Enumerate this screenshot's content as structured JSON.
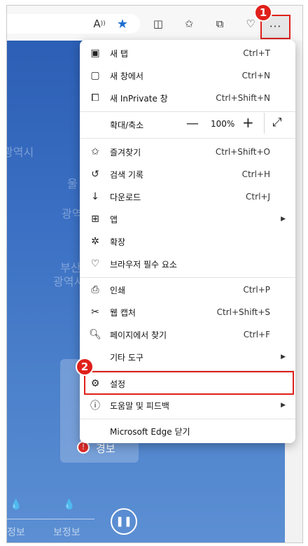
{
  "toolbar": {
    "icons": [
      "read-aloud-icon",
      "favorite-star-icon",
      "split-screen-icon",
      "favorites-icon",
      "collections-icon",
      "browser-essentials-icon"
    ],
    "more_label": "···"
  },
  "background": {
    "map_labels": [
      "광역시",
      "울",
      "광역",
      "부산",
      "광역시"
    ],
    "legend_label": "경보",
    "bottom_labels": [
      "정보",
      "보정보"
    ]
  },
  "menu": {
    "items": [
      {
        "label": "새 탭",
        "shortcut": "Ctrl+T",
        "icon": "new-tab-icon"
      },
      {
        "label": "새 창에서",
        "shortcut": "Ctrl+N",
        "icon": "new-window-icon"
      },
      {
        "label": "새 InPrivate 창",
        "shortcut": "Ctrl+Shift+N",
        "icon": "inprivate-icon"
      },
      {
        "label": "확대/축소",
        "icon": "none"
      },
      {
        "label": "즐겨찾기",
        "shortcut": "Ctrl+Shift+O",
        "icon": "favorites-icon"
      },
      {
        "label": "검색 기록",
        "shortcut": "Ctrl+H",
        "icon": "history-icon"
      },
      {
        "label": "다운로드",
        "shortcut": "Ctrl+J",
        "icon": "download-icon"
      },
      {
        "label": "앱",
        "icon": "apps-icon"
      },
      {
        "label": "확장",
        "icon": "extensions-icon"
      },
      {
        "label": "브라우저 필수 요소",
        "icon": "browser-essentials-icon"
      },
      {
        "label": "인쇄",
        "shortcut": "Ctrl+P",
        "icon": "print-icon"
      },
      {
        "label": "웹 캡처",
        "shortcut": "Ctrl+Shift+S",
        "icon": "web-capture-icon"
      },
      {
        "label": "페이지에서 찾기",
        "shortcut": "Ctrl+F",
        "icon": "find-icon"
      },
      {
        "label": "기타 도구",
        "icon": "none"
      },
      {
        "label": "설정",
        "icon": "gear-icon"
      },
      {
        "label": "도움말 및 피드백",
        "icon": "help-icon"
      },
      {
        "label": "Microsoft Edge 닫기",
        "icon": "none"
      }
    ],
    "zoom": {
      "value": "100%",
      "minus": "—",
      "plus": "+",
      "expand": "⤢"
    }
  },
  "annotations": {
    "badge1": "1",
    "badge2": "2"
  },
  "colors": {
    "highlight": "#e0201b",
    "accent": "#1f6fd1"
  }
}
